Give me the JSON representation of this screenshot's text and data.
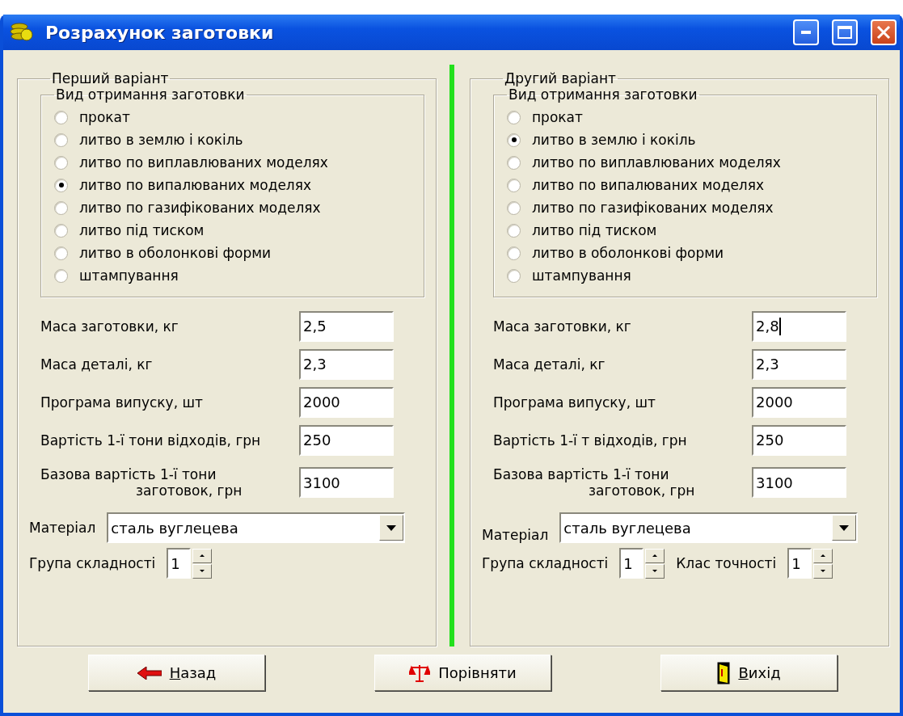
{
  "window": {
    "title": "Розрахунок заготовки"
  },
  "variants": [
    {
      "title": "Перший варіант",
      "method_title": "Вид отримання заготовки",
      "methods": [
        {
          "label": "прокат",
          "selected": false
        },
        {
          "label": "литво в землю і кокіль",
          "selected": false
        },
        {
          "label": "литво по виплавлюваних моделях",
          "selected": false
        },
        {
          "label": "литво по випалюваних моделях",
          "selected": true
        },
        {
          "label": "литво по газифікованих моделях",
          "selected": false
        },
        {
          "label": "литво під тиском",
          "selected": false
        },
        {
          "label": "литво в оболонкові форми",
          "selected": false
        },
        {
          "label": "штампування",
          "selected": false
        }
      ],
      "fields": [
        {
          "label": "Маса заготовки, кг",
          "value": "2,5"
        },
        {
          "label": "Маса деталі, кг",
          "value": "2,3"
        },
        {
          "label": "Програма випуску, шт",
          "value": "2000"
        },
        {
          "label": "Вартість 1-ї тони відходів, грн",
          "value": "250"
        },
        {
          "label": "Базова вартість 1-ї тони",
          "label_2": "заготовок, грн",
          "value": "3100"
        }
      ],
      "material": {
        "label": "Матеріал",
        "value": "сталь вуглецева"
      },
      "spinners": [
        {
          "label": "Група складності",
          "value": "1"
        }
      ]
    },
    {
      "title": "Другий  варіант",
      "method_title": "Вид отримання заготовки",
      "methods": [
        {
          "label": "прокат",
          "selected": false
        },
        {
          "label": "литво в землю і кокіль",
          "selected": true
        },
        {
          "label": "литво по виплавлюваних моделях",
          "selected": false
        },
        {
          "label": "литво по випалюваних моделях",
          "selected": false
        },
        {
          "label": "литво по газифікованих моделях",
          "selected": false
        },
        {
          "label": "литво під тиском",
          "selected": false
        },
        {
          "label": "литво в оболонкові форми",
          "selected": false
        },
        {
          "label": "штампування",
          "selected": false
        }
      ],
      "fields": [
        {
          "label": "Маса заготовки, кг",
          "value": "2,8",
          "focused": true
        },
        {
          "label": "Маса деталі, кг",
          "value": "2,3"
        },
        {
          "label": "Програма випуску, шт",
          "value": "2000"
        },
        {
          "label": "Вартість 1-ї т відходів, грн",
          "value": "250"
        },
        {
          "label": "Базова вартість 1-ї тони",
          "label_2": "заготовок, грн",
          "value": "3100"
        }
      ],
      "material": {
        "label": "Матеріал",
        "value": "сталь вуглецева"
      },
      "spinners": [
        {
          "label": "Група складності",
          "value": "1"
        },
        {
          "label": "Клас точності",
          "value": "1"
        }
      ]
    }
  ],
  "buttons": [
    {
      "kind": "back",
      "label": "Назад",
      "underline_first": true
    },
    {
      "kind": "compare",
      "label": "Порівняти",
      "underline_first": false
    },
    {
      "kind": "exit",
      "label": "Вихід",
      "underline_first": true
    }
  ]
}
